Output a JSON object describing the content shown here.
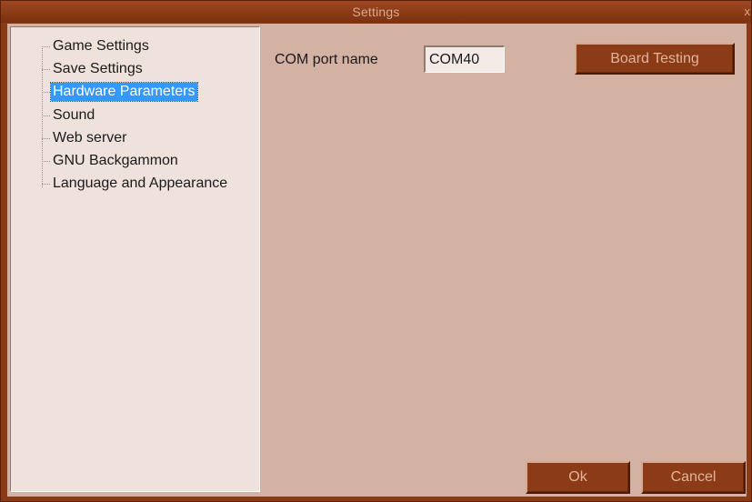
{
  "window": {
    "title": "Settings",
    "close_glyph": "x"
  },
  "tree": {
    "items": [
      {
        "label": "Game Settings",
        "selected": false
      },
      {
        "label": "Save Settings",
        "selected": false
      },
      {
        "label": "Hardware Parameters",
        "selected": true
      },
      {
        "label": "Sound",
        "selected": false
      },
      {
        "label": "Web server",
        "selected": false
      },
      {
        "label": "GNU Backgammon",
        "selected": false
      },
      {
        "label": "Language and Appearance",
        "selected": false
      }
    ]
  },
  "hardware": {
    "com_port_label": "COM port name",
    "com_port_value": "COM40",
    "board_testing_label": "Board Testing"
  },
  "footer": {
    "ok_label": "Ok",
    "cancel_label": "Cancel"
  },
  "colors": {
    "window_frame": "#8a3a17",
    "client_background": "#d4b2a3",
    "tree_background": "#efe2dc",
    "selection": "#3399ff",
    "button_background": "#8b3b16",
    "button_text": "#e2b49c"
  }
}
